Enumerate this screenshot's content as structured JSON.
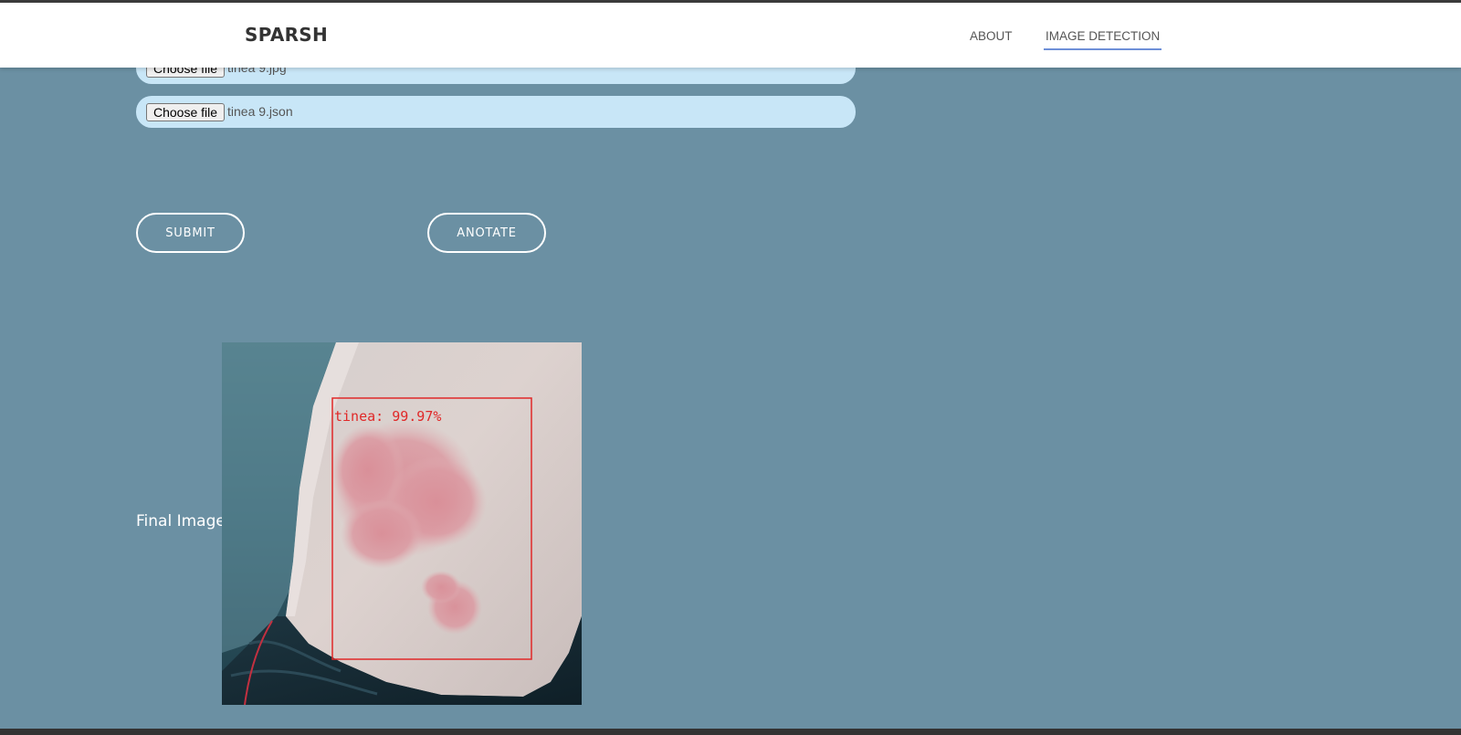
{
  "header": {
    "brand": "SPARSH",
    "nav": [
      {
        "label": "ABOUT",
        "active": false
      },
      {
        "label": "IMAGE DETECTION",
        "active": true
      }
    ]
  },
  "upload": {
    "image_file": {
      "button": "Choose file",
      "filename": "tinea 9.jpg"
    },
    "json_file": {
      "button": "Choose file",
      "filename": "tinea 9.json"
    }
  },
  "actions": {
    "submit": "SUBMIT",
    "anotate": "ANOTATE"
  },
  "result": {
    "label": "Final Image",
    "detection_label": "tinea: 99.97%"
  },
  "colors": {
    "background": "#6b90a3",
    "navbar": "#ffffff",
    "file_input_bg": "#c8e6f7",
    "active_underline": "#6e8fd8",
    "detection_box": "#e02828"
  }
}
